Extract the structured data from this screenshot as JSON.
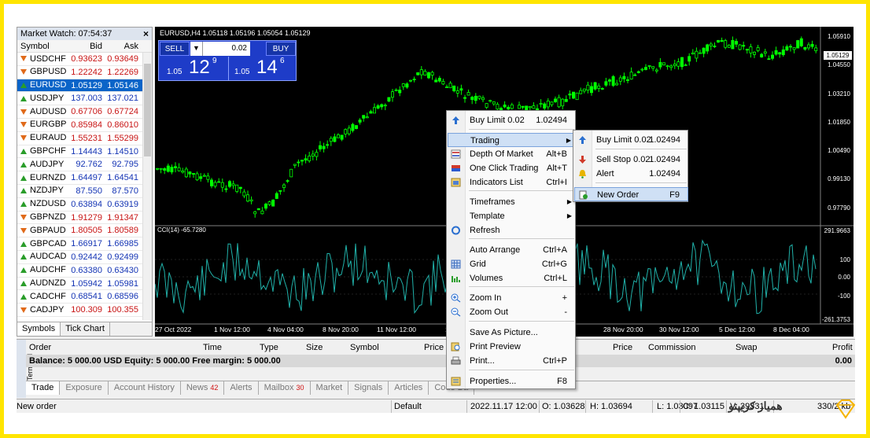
{
  "market_watch": {
    "title": "Market Watch: 07:54:37",
    "columns": [
      "Symbol",
      "Bid",
      "Ask"
    ],
    "rows": [
      {
        "symbol": "USDCHF",
        "bid": "0.93623",
        "ask": "0.93649",
        "dir": "down",
        "color": "red"
      },
      {
        "symbol": "GBPUSD",
        "bid": "1.22242",
        "ask": "1.22269",
        "dir": "down",
        "color": "red"
      },
      {
        "symbol": "EURUSD",
        "bid": "1.05129",
        "ask": "1.05146",
        "dir": "up",
        "color": "sel"
      },
      {
        "symbol": "USDJPY",
        "bid": "137.003",
        "ask": "137.021",
        "dir": "up",
        "color": "blue"
      },
      {
        "symbol": "AUDUSD",
        "bid": "0.67706",
        "ask": "0.67724",
        "dir": "down",
        "color": "red"
      },
      {
        "symbol": "EURGBP",
        "bid": "0.85984",
        "ask": "0.86010",
        "dir": "down",
        "color": "red"
      },
      {
        "symbol": "EURAUD",
        "bid": "1.55231",
        "ask": "1.55299",
        "dir": "down",
        "color": "red"
      },
      {
        "symbol": "GBPCHF",
        "bid": "1.14443",
        "ask": "1.14510",
        "dir": "up",
        "color": "blue"
      },
      {
        "symbol": "AUDJPY",
        "bid": "92.762",
        "ask": "92.795",
        "dir": "up",
        "color": "blue"
      },
      {
        "symbol": "EURNZD",
        "bid": "1.64497",
        "ask": "1.64541",
        "dir": "up",
        "color": "blue"
      },
      {
        "symbol": "NZDJPY",
        "bid": "87.550",
        "ask": "87.570",
        "dir": "up",
        "color": "blue"
      },
      {
        "symbol": "NZDUSD",
        "bid": "0.63894",
        "ask": "0.63919",
        "dir": "up",
        "color": "blue"
      },
      {
        "symbol": "GBPNZD",
        "bid": "1.91279",
        "ask": "1.91347",
        "dir": "down",
        "color": "red"
      },
      {
        "symbol": "GBPAUD",
        "bid": "1.80505",
        "ask": "1.80589",
        "dir": "down",
        "color": "red"
      },
      {
        "symbol": "GBPCAD",
        "bid": "1.66917",
        "ask": "1.66985",
        "dir": "up",
        "color": "blue"
      },
      {
        "symbol": "AUDCAD",
        "bid": "0.92442",
        "ask": "0.92499",
        "dir": "up",
        "color": "blue"
      },
      {
        "symbol": "AUDCHF",
        "bid": "0.63380",
        "ask": "0.63430",
        "dir": "up",
        "color": "blue"
      },
      {
        "symbol": "AUDNZD",
        "bid": "1.05942",
        "ask": "1.05981",
        "dir": "up",
        "color": "blue"
      },
      {
        "symbol": "CADCHF",
        "bid": "0.68541",
        "ask": "0.68596",
        "dir": "up",
        "color": "blue"
      },
      {
        "symbol": "CADJPY",
        "bid": "100.309",
        "ask": "100.355",
        "dir": "down",
        "color": "red"
      }
    ],
    "tabs": [
      "Symbols",
      "Tick Chart"
    ]
  },
  "chart": {
    "title": "EURUSD,H4  1.05118 1.05196 1.05054 1.05129",
    "sell_label": "SELL",
    "buy_label": "BUY",
    "lots": "0.02",
    "sell_prefix": "1.05",
    "sell_big": "12",
    "sell_sup": "9",
    "buy_prefix": "1.05",
    "buy_big": "14",
    "buy_sup": "6",
    "current_price": "1.05129",
    "y_labels": [
      "1.05910",
      "1.04550",
      "1.03210",
      "1.01850",
      "1.00490",
      "0.99130",
      "0.97790"
    ],
    "cci_label": "CCI(14) -65.7280",
    "cci_labels": [
      "291.9663",
      "100",
      "0.00",
      "-100",
      "-261.3753"
    ],
    "x_labels": [
      "27 Oct 2022",
      "1 Nov 12:00",
      "4 Nov 04:00",
      "8 Nov 20:00",
      "11 Nov 12:00",
      "16 N",
      "28 Nov 20:00",
      "30 Nov 12:00",
      "5 Dec 12:00",
      "8 Dec 04:00"
    ]
  },
  "terminal": {
    "side_label": "Terminal",
    "headers": [
      "Order",
      "Time",
      "Type",
      "Size",
      "Symbol",
      "Price",
      "Price",
      "Commission",
      "Swap",
      "Profit"
    ],
    "balance": "Balance: 5 000.00 USD  Equity: 5 000.00  Free margin: 5 000.00",
    "balance_value": "0.00",
    "tabs": [
      {
        "label": "Trade",
        "badge": ""
      },
      {
        "label": "Exposure",
        "badge": ""
      },
      {
        "label": "Account History",
        "badge": ""
      },
      {
        "label": "News",
        "badge": "42"
      },
      {
        "label": "Alerts",
        "badge": ""
      },
      {
        "label": "Mailbox",
        "badge": "30"
      },
      {
        "label": "Market",
        "badge": ""
      },
      {
        "label": "Signals",
        "badge": ""
      },
      {
        "label": "Articles",
        "badge": ""
      },
      {
        "label": "Code Ba",
        "badge": ""
      }
    ]
  },
  "status": {
    "left": "New order",
    "profile": "Default",
    "time": "2022.11.17 12:00",
    "open": "O: 1.03628",
    "high": "H: 1.03694",
    "low": "L: 1.03097",
    "close": "C: 1.03115",
    "volume": "V: 39331",
    "traffic": "330/2 kb"
  },
  "context_menu": {
    "items": [
      {
        "label": "Buy Limit 0.02",
        "shortcut": "1.02494",
        "icon": "buy-limit-icon"
      },
      {
        "label": "Trading",
        "shortcut": "",
        "icon": "",
        "submenu": true
      },
      {
        "label": "Depth Of Market",
        "shortcut": "Alt+B",
        "icon": "depth-of-market-icon"
      },
      {
        "label": "One Click Trading",
        "shortcut": "Alt+T",
        "icon": "one-click-trading-icon"
      },
      {
        "label": "Indicators List",
        "shortcut": "Ctrl+I",
        "icon": "indicators-list-icon"
      },
      {
        "label": "Timeframes",
        "shortcut": "",
        "icon": "",
        "submenu": true
      },
      {
        "label": "Template",
        "shortcut": "",
        "icon": "",
        "submenu": true
      },
      {
        "label": "Refresh",
        "shortcut": "",
        "icon": "refresh-icon"
      },
      {
        "label": "Auto Arrange",
        "shortcut": "Ctrl+A",
        "icon": ""
      },
      {
        "label": "Grid",
        "shortcut": "Ctrl+G",
        "icon": "grid-icon"
      },
      {
        "label": "Volumes",
        "shortcut": "Ctrl+L",
        "icon": "volumes-icon"
      },
      {
        "label": "Zoom In",
        "shortcut": "+",
        "icon": "zoom-in-icon"
      },
      {
        "label": "Zoom Out",
        "shortcut": "-",
        "icon": "zoom-out-icon"
      },
      {
        "label": "Save As Picture...",
        "shortcut": "",
        "icon": ""
      },
      {
        "label": "Print Preview",
        "shortcut": "",
        "icon": "print-preview-icon"
      },
      {
        "label": "Print...",
        "shortcut": "Ctrl+P",
        "icon": "print-icon"
      },
      {
        "label": "Properties...",
        "shortcut": "F8",
        "icon": "properties-icon"
      }
    ]
  },
  "trading_submenu": {
    "items": [
      {
        "label": "Buy Limit 0.02",
        "shortcut": "1.02494",
        "icon": "buy-limit-icon"
      },
      {
        "label": "Sell Stop 0.02",
        "shortcut": "1.02494",
        "icon": "sell-stop-icon"
      },
      {
        "label": "Alert",
        "shortcut": "1.02494",
        "icon": "alert-bell-icon"
      },
      {
        "label": "New Order",
        "shortcut": "F9",
        "icon": "new-order-icon"
      }
    ]
  },
  "watermark": {
    "text": "همیار کریپتو"
  },
  "colors": {
    "frame": "#ffe500",
    "chart_bg": "#000000",
    "candle": "#00ff00",
    "cci": "#20b2aa",
    "selection": "#0a64c8",
    "sell_panel": "#1e3cc8"
  }
}
